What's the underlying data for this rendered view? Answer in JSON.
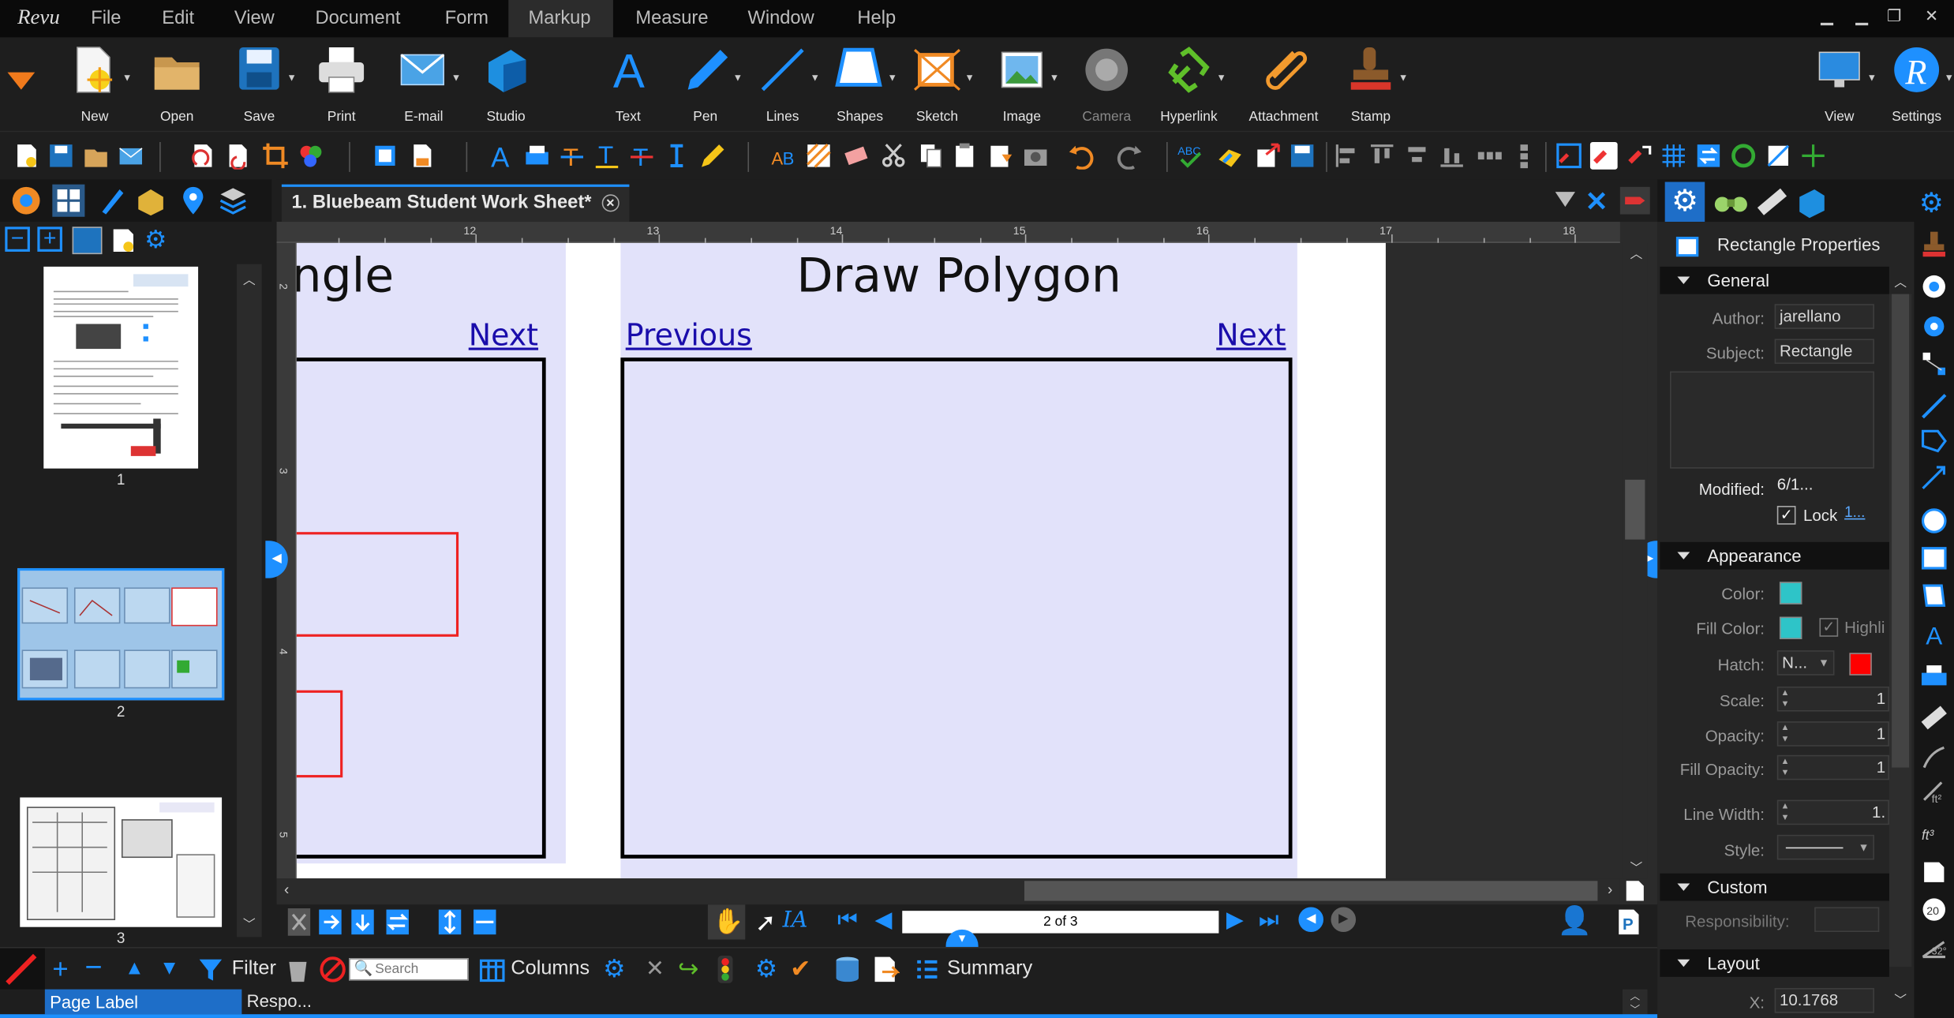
{
  "app": {
    "logo": "Revu"
  },
  "menu": [
    "File",
    "Edit",
    "View",
    "Document",
    "Form",
    "Markup",
    "Measure",
    "Window",
    "Help"
  ],
  "menu_active": "Markup",
  "ribbon": {
    "new": "New",
    "open": "Open",
    "save": "Save",
    "print": "Print",
    "email": "E-mail",
    "studio": "Studio",
    "text": "Text",
    "pen": "Pen",
    "lines": "Lines",
    "shapes": "Shapes",
    "sketch": "Sketch",
    "image": "Image",
    "camera": "Camera",
    "hyperlink": "Hyperlink",
    "attachment": "Attachment",
    "stamp": "Stamp",
    "view": "View",
    "settings": "Settings"
  },
  "thumbnails": [
    "1",
    "2",
    "3"
  ],
  "doc": {
    "tab_title": "1. Bluebeam Student Work Sheet*",
    "left_title": "ngle",
    "heading": "Draw Polygon",
    "link_next_left": "Next",
    "link_previous": "Previous",
    "link_next_right": "Next"
  },
  "ruler_h": [
    "12",
    "13",
    "14",
    "15",
    "16",
    "17",
    "18"
  ],
  "ruler_v": [
    "2",
    "3",
    "4",
    "5"
  ],
  "nav": {
    "page_display": "2 of 3"
  },
  "markup_list": {
    "filter": "Filter",
    "search_placeholder": "Search",
    "columns": "Columns",
    "summary": "Summary",
    "col_page_label": "Page Label",
    "col_respo": "Respo..."
  },
  "properties": {
    "title": "Rectangle Properties",
    "general": "General",
    "author_label": "Author:",
    "author": "jarellano",
    "subject_label": "Subject:",
    "subject": "Rectangle",
    "modified_label": "Modified:",
    "modified": "6/1...",
    "lock": "Lock",
    "appearance": "Appearance",
    "color_label": "Color:",
    "fill_color_label": "Fill Color:",
    "highlight": "Highli",
    "hatch_label": "Hatch:",
    "hatch": "N...",
    "scale_label": "Scale:",
    "scale": "1",
    "opacity_label": "Opacity:",
    "opacity": "1",
    "fill_opacity_label": "Fill Opacity:",
    "fill_opacity": "1",
    "line_width_label": "Line Width:",
    "line_width": "1.",
    "style_label": "Style:",
    "custom": "Custom",
    "responsibility_label": "Responsibility:",
    "layout": "Layout",
    "x_label": "X:",
    "x": "10.1768"
  },
  "colors": {
    "accent": "#1e90ff",
    "fill": "#2ec4c8",
    "hatch_color": "#ff0000",
    "panel": "#e2e2fa",
    "link": "#1a0dab"
  }
}
